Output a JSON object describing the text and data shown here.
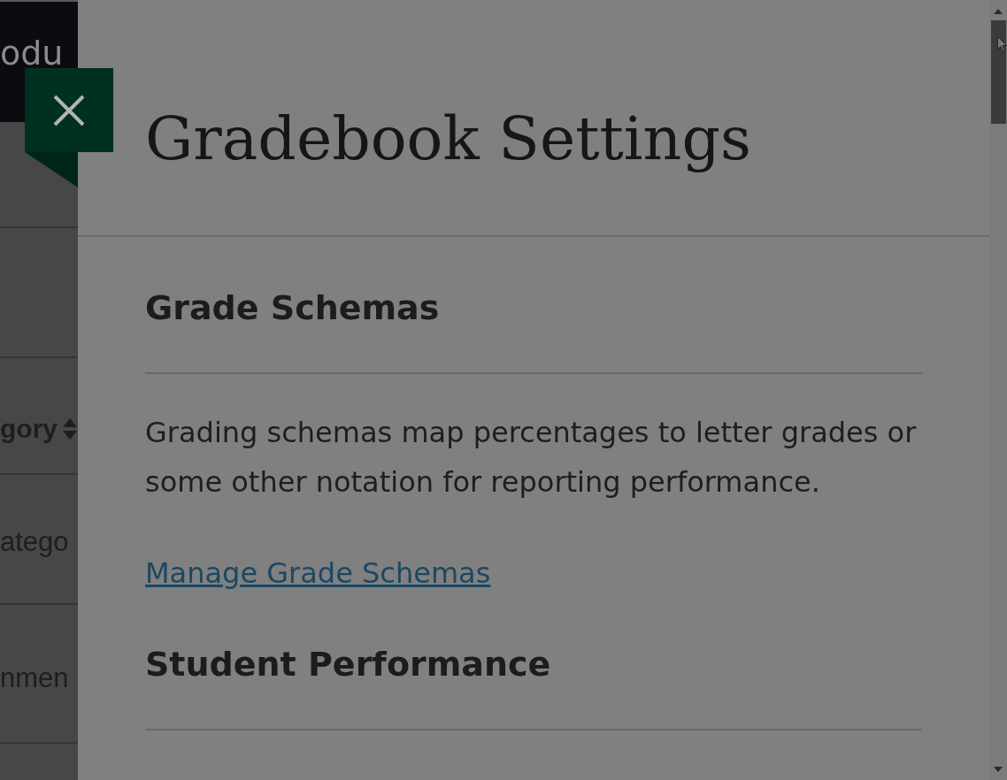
{
  "background_page": {
    "header_text": "odu",
    "table": {
      "column_header": "gory",
      "cells": [
        "atego",
        "nmen"
      ]
    }
  },
  "panel": {
    "title": "Gradebook Settings",
    "sections": [
      {
        "heading": "Grade Schemas",
        "text": "Grading schemas map percentages to letter grades or some other notation for reporting performance.",
        "link": "Manage Grade Schemas"
      },
      {
        "heading": "Student Performance"
      }
    ]
  }
}
